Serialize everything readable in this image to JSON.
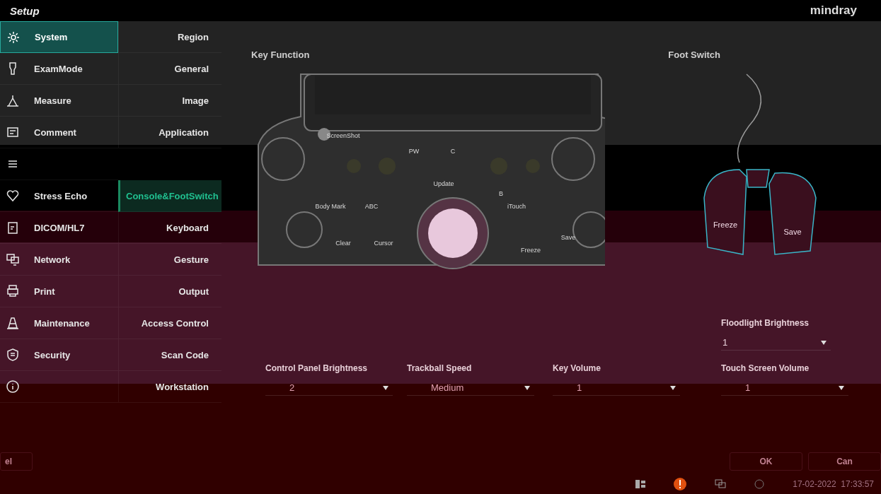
{
  "window": {
    "title": "Setup",
    "brand": "mindray"
  },
  "sidebar": {
    "items": [
      {
        "label": "System",
        "selected": true
      },
      {
        "label": "ExamMode",
        "selected": false
      },
      {
        "label": "Measure",
        "selected": false
      },
      {
        "label": "Comment",
        "selected": false
      },
      {
        "selected": false
      },
      {
        "label": "Stress Echo",
        "selected": false
      },
      {
        "label": "DICOM/HL7",
        "selected": false
      },
      {
        "label": "Network",
        "selected": false
      },
      {
        "label": "Print",
        "selected": false
      },
      {
        "label": "Maintenance",
        "selected": false
      },
      {
        "label": "Security",
        "selected": false
      },
      {
        "selected": false
      }
    ]
  },
  "submenu": {
    "items": [
      {
        "label": "Region",
        "selected": false
      },
      {
        "label": "General",
        "selected": false
      },
      {
        "label": "Image",
        "selected": false
      },
      {
        "label": "Application",
        "selected": false
      },
      {
        "label": "Console&FootSwitch",
        "selected": true
      },
      {
        "label": "Keyboard",
        "selected": false
      },
      {
        "label": "Gesture",
        "selected": false
      },
      {
        "label": "Output",
        "selected": false
      },
      {
        "label": "Access Control",
        "selected": false
      },
      {
        "label": "Scan Code",
        "selected": false
      },
      {
        "label": "Workstation",
        "selected": false
      }
    ]
  },
  "key_function": {
    "title": "Key Function",
    "keys": [
      "ScreenShot",
      "PW",
      "C",
      "Update",
      "B",
      "Body Mark",
      "ABC",
      "iTouch",
      "Clear",
      "Cursor",
      "Freeze",
      "Save"
    ]
  },
  "foot_switch": {
    "title": "Foot Switch",
    "pedals": [
      "Freeze",
      "Save"
    ]
  },
  "settings": [
    {
      "label": "Floodlight Brightness",
      "value": "1"
    },
    {
      "label": "Control Panel Brightness",
      "value": "2"
    },
    {
      "label": "Trackball Speed",
      "value": "Medium"
    },
    {
      "label": "Key Volume",
      "value": "1"
    },
    {
      "label": "Touch Screen Volume",
      "value": "1"
    }
  ],
  "left_button": "el",
  "buttons": [
    "OK",
    "Can"
  ],
  "status_bar": {
    "datetime": "17-02-2022  17:33:57"
  }
}
